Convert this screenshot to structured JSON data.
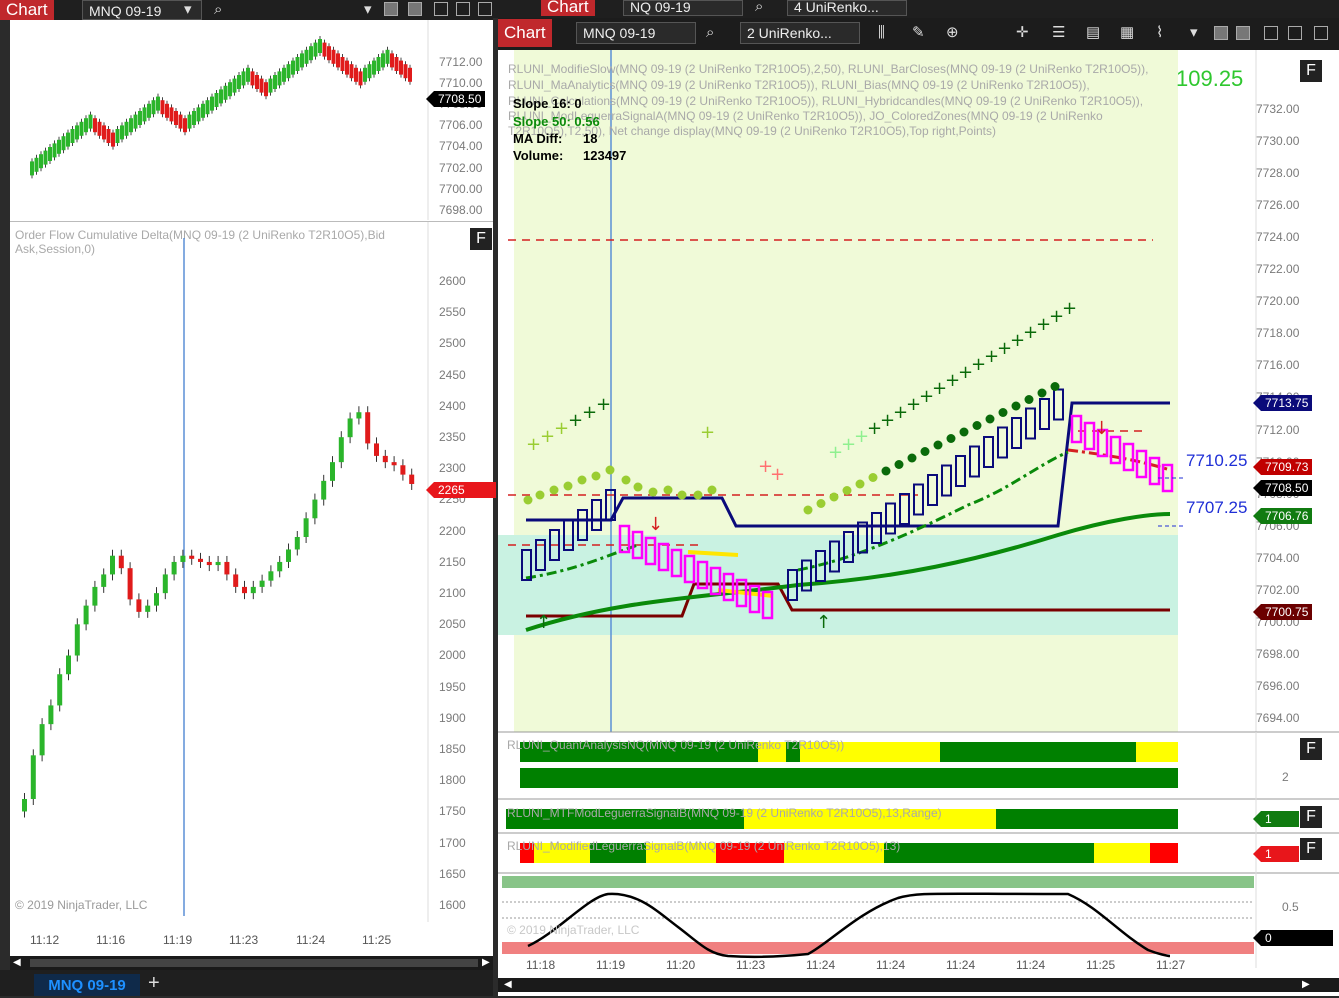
{
  "left_window": {
    "chip": "Chart",
    "instrument": "MNQ 09-19",
    "price_tag": "7708.50",
    "delta_tag": "2265",
    "indicator_label": "Order Flow Cumulative Delta(MNQ 09-19 (2 UniRenko T2R10O5),Bid Ask,Session,0)",
    "f_label": "F",
    "copyright": "© 2019 NinjaTrader, LLC",
    "price_axis": [
      "7712.00",
      "7710.00",
      "7708.00",
      "7706.00",
      "7704.00",
      "7702.00",
      "7700.00",
      "7698.00"
    ],
    "delta_axis": [
      "2600",
      "2550",
      "2500",
      "2450",
      "2400",
      "2350",
      "2300",
      "2250",
      "2200",
      "2150",
      "2100",
      "2050",
      "2000",
      "1950",
      "1900",
      "1850",
      "1800",
      "1750",
      "1700",
      "1650",
      "1600"
    ],
    "time_axis": [
      "11:12",
      "11:16",
      "11:19",
      "11:23",
      "11:24",
      "11:25"
    ],
    "tab": "MNQ 09-19",
    "add_tab": "+"
  },
  "back_window": {
    "chip": "Chart",
    "instrument": "NQ 09-19",
    "series": "4 UniRenko..."
  },
  "right_window": {
    "chip": "Chart",
    "instrument": "MNQ 09-19",
    "series": "2 UniRenko...",
    "net_change": "109.25",
    "f_label": "F",
    "indicator_lines": [
      "RLUNI_ModifieSlow(MNQ 09-19 (2 UniRenko T2R10O5),2,50), RLUNI_BarCloses(MNQ 09-19 (2 UniRenko T2R10O5)),",
      "RLUNI_MaAnalytics(MNQ 09-19 (2 UniRenko T2R10O5)), RLUNI_Bias(MNQ 09-19 (2 UniRenko T2R10O5)),",
      "RLUNI_Calculations(MNQ 09-19 (2 UniRenko T2R10O5)), RLUNI_Hybridcandles(MNQ 09-19 (2 UniRenko T2R10O5)),",
      "RLUNI_ModLeguerraSignalA(MNQ 09-19 (2 UniRenko T2R10O5)), JO_ColoredZones(MNQ 09-19 (2 UniRenko",
      "T2R10O5),T2,50), Net change display(MNQ 09-19 (2 UniRenko T2R10O5),Top right,Points)"
    ],
    "stats": {
      "slope16": "Slope 16: 0",
      "slope50": "Slope 50: 0.56",
      "madiff_label": "MA Diff:",
      "madiff_value": "18",
      "volume_label": "Volume:",
      "volume_value": "123497"
    },
    "price_axis": [
      "7732.00",
      "7730.00",
      "7728.00",
      "7726.00",
      "7724.00",
      "7722.00",
      "7720.00",
      "7718.00",
      "7716.00",
      "7714.00",
      "7712.00",
      "7710.00",
      "7708.00",
      "7706.00",
      "7704.00",
      "7702.00",
      "7700.00",
      "7698.00",
      "7696.00",
      "7694.00"
    ],
    "price_tags": {
      "top": "7713.75",
      "red": "7709.73",
      "black": "7708.50",
      "green": "7706.76",
      "bottom": "7700.75"
    },
    "level_labels": {
      "upper": "7710.25",
      "lower": "7707.25"
    },
    "panel_quant": {
      "label": "RLUNI_QuantAnalysisNQ(MNQ 09-19 (2 UniRenko T2R10O5))",
      "axis": "2"
    },
    "panel_mtf": {
      "label": "RLUNI_MTFModLeguerraSignalB(MNQ 09-19 (2 UniRenko T2R10O5),13,Range)",
      "tag": "1"
    },
    "panel_mod": {
      "label": "RLUNI_ModifiedLeguerraSignalB(MNQ 09-19 (2 UniRenko T2R10O5),13)",
      "tag": "1"
    },
    "panel_osc": {
      "axis": "0.5",
      "tag": "0"
    },
    "copyright": "© 2019 NinjaTrader, LLC",
    "time_axis": [
      "11:18",
      "11:19",
      "11:20",
      "11:23",
      "11:24",
      "11:24",
      "11:24",
      "11:24",
      "11:25",
      "11:27"
    ]
  },
  "colors": {
    "chip_red": "#c0282c",
    "up_bar": "#2bb52b",
    "down_bar": "#e01b1b",
    "navy": "#0a0a7a",
    "magenta": "#ff00ff",
    "dark_green": "#006400",
    "lime_bg": "#f0fad8",
    "teal_zone": "#c9f2e2"
  }
}
